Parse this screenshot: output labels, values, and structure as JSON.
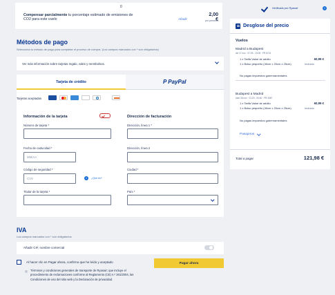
{
  "top": {
    "zero": "0",
    "co2_bold": "Compensar parcialmente",
    "co2_text": " tu porcentaje estimado de emisiones de CO2 para este vuelo",
    "add_link": "Añadir",
    "price": "2,00 €",
    "per_person": "por persona"
  },
  "payment": {
    "title": "Métodos de pago",
    "subtitle": "Selecciona tu método de pago para completar el proceso de compra.  (Los campos marcados con * son obligatorios)",
    "info_toggle": "Ver más información sobre tarjetas regalo, vales y reembolsos.",
    "tab_card": "Tarjeta de crédito",
    "tab_paypal": "PayPal",
    "accepted_label": "Tarjetas aceptadas"
  },
  "card_info": {
    "heading": "Información de la tarjeta",
    "number_label": "Número de tarjeta *",
    "expiry_label": "Fecha de caducidad *",
    "expiry_placeholder": "MM/AA",
    "cvv_label": "Código de seguridad *",
    "cvv_placeholder": "CVV",
    "whats_this": "¿Qué es?",
    "holder_label": "Titular de la tarjeta *"
  },
  "billing": {
    "heading": "Dirección de facturación",
    "line1_label": "Dirección, línea 1 *",
    "line2_label": "Dirección, línea 2",
    "city_label": "Ciudad *",
    "country_label": "País *"
  },
  "vat": {
    "title": "IVA",
    "subtitle": "Los campos marcados con * son obligatorios",
    "add_cif": "Añadir CIF, nombre comercial"
  },
  "consent": {
    "text": "Al hacer clic en Pagar ahora, confirmo que he leído y aceptado",
    "pay_button": "Pagar ahora",
    "terms": "Términos y condiciones generales de transporte de Ryanair; que incluye el procedimiento de reclamaciones conforme al Reglamento (CE) n.º 261/2004, las Condiciones de uso del sitio web y la Declaración de privacidad."
  },
  "verified": "Verificado por Ryanair",
  "breakdown": {
    "title": "Desglose del precio",
    "flights_heading": "Vuelos",
    "legs": [
      {
        "route": "Madrid a Budapest",
        "meta": "vie 17 nov · 07:25 - 10:05 · FR 6713",
        "fare": "1 x Tarifa Value de adulto",
        "fare_price": "60,99 €",
        "bag": "1 x Bolso pequeño (40cm x 20cm x 25cm)",
        "bag_price": "Incluido",
        "taxes": "No pagas impuestos gubernamentales"
      },
      {
        "route": "Budapest a Madrid",
        "meta": "dom 26 nov · 21:20 - 00:40 · FR 3367",
        "fare": "1 x Tarifa Value de adulto",
        "fare_price": "60,99 €",
        "bag": "1 x Bolso pequeño (40cm x 20cm x 25cm)",
        "bag_price": "Incluido",
        "taxes": "No pagas impuestos gubernamentales"
      }
    ],
    "passengers": "Pasajeros",
    "total_label": "Total a pagar",
    "total_value": "121,98 €"
  },
  "colors": {
    "brand_blue": "#073590",
    "accent_yellow": "#f1c933",
    "page_bg": "#eef0f4",
    "mastercard_red": "#eb001b",
    "mastercard_orange": "#f79e1b"
  }
}
